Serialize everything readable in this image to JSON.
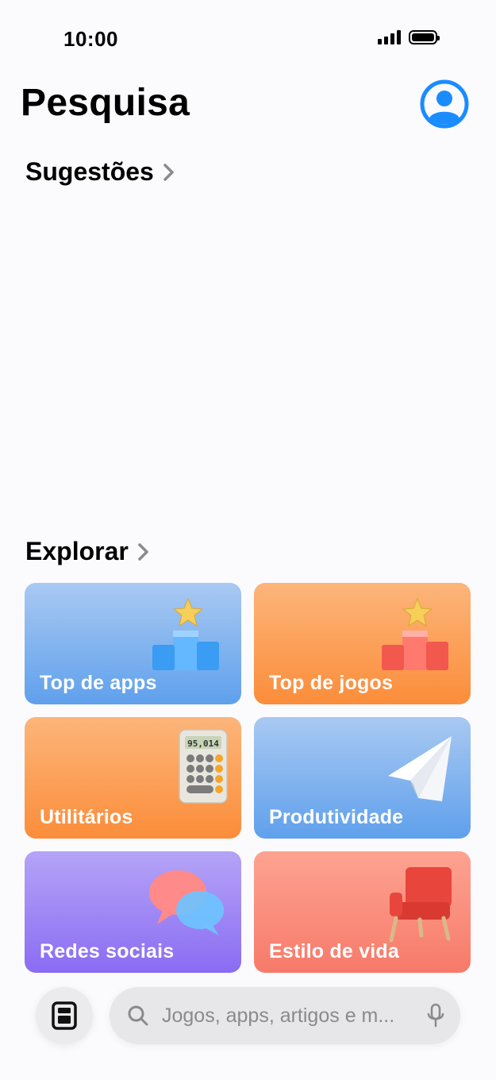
{
  "status_bar": {
    "time": "10:00"
  },
  "header": {
    "title": "Pesquisa"
  },
  "sections": {
    "suggestions": {
      "label": "Sugestões"
    },
    "explore": {
      "label": "Explorar"
    }
  },
  "categories": [
    {
      "label": "Top de apps",
      "color": "#5fa0ec",
      "icon": "podium-star-icon"
    },
    {
      "label": "Top de jogos",
      "color": "#fb8d3a",
      "icon": "podium-star-icon"
    },
    {
      "label": "Utilitários",
      "color": "#fb8d3a",
      "icon": "calculator-icon",
      "calculator_display": "95,014"
    },
    {
      "label": "Produtividade",
      "color": "#5fa0ec",
      "icon": "paper-plane-icon"
    },
    {
      "label": "Redes sociais",
      "color": "#8a6cf4",
      "icon": "speech-bubbles-icon"
    },
    {
      "label": "Estilo de vida",
      "color": "#f77a6a",
      "icon": "armchair-icon"
    }
  ],
  "bottom_bar": {
    "search_placeholder": "Jogos, apps, artigos e m..."
  },
  "colors": {
    "accent": "#1a8cff",
    "background": "#fbfbfd"
  }
}
